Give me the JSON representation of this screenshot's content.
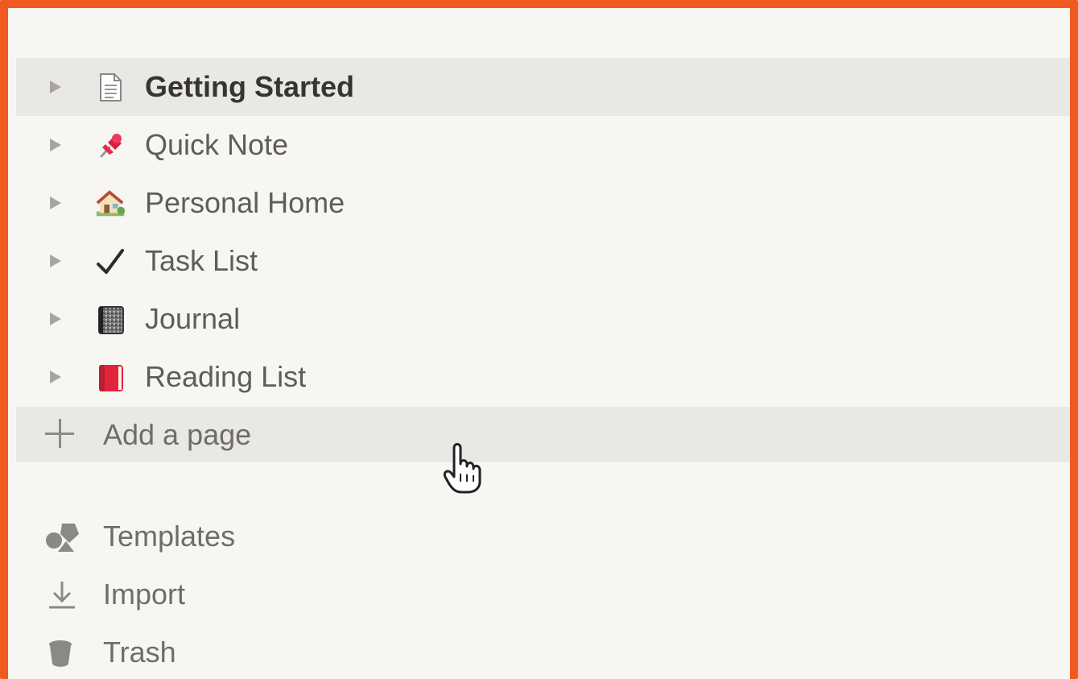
{
  "sidebar": {
    "pages": [
      {
        "label": "Getting Started",
        "icon": "document-icon",
        "active": true
      },
      {
        "label": "Quick Note",
        "icon": "pushpin-icon",
        "active": false
      },
      {
        "label": "Personal Home",
        "icon": "house-icon",
        "active": false
      },
      {
        "label": "Task List",
        "icon": "checkmark-icon",
        "active": false
      },
      {
        "label": "Journal",
        "icon": "notebook-icon",
        "active": false
      },
      {
        "label": "Reading List",
        "icon": "red-book-icon",
        "active": false
      }
    ],
    "add_page_label": "Add a page",
    "utilities": [
      {
        "label": "Templates",
        "icon": "templates-icon"
      },
      {
        "label": "Import",
        "icon": "import-icon"
      },
      {
        "label": "Trash",
        "icon": "trash-icon"
      }
    ]
  },
  "colors": {
    "background": "#f7f6f3",
    "active_row": "#e9e8e5",
    "frame": "#f05a1f",
    "text": "#5f5d59"
  }
}
